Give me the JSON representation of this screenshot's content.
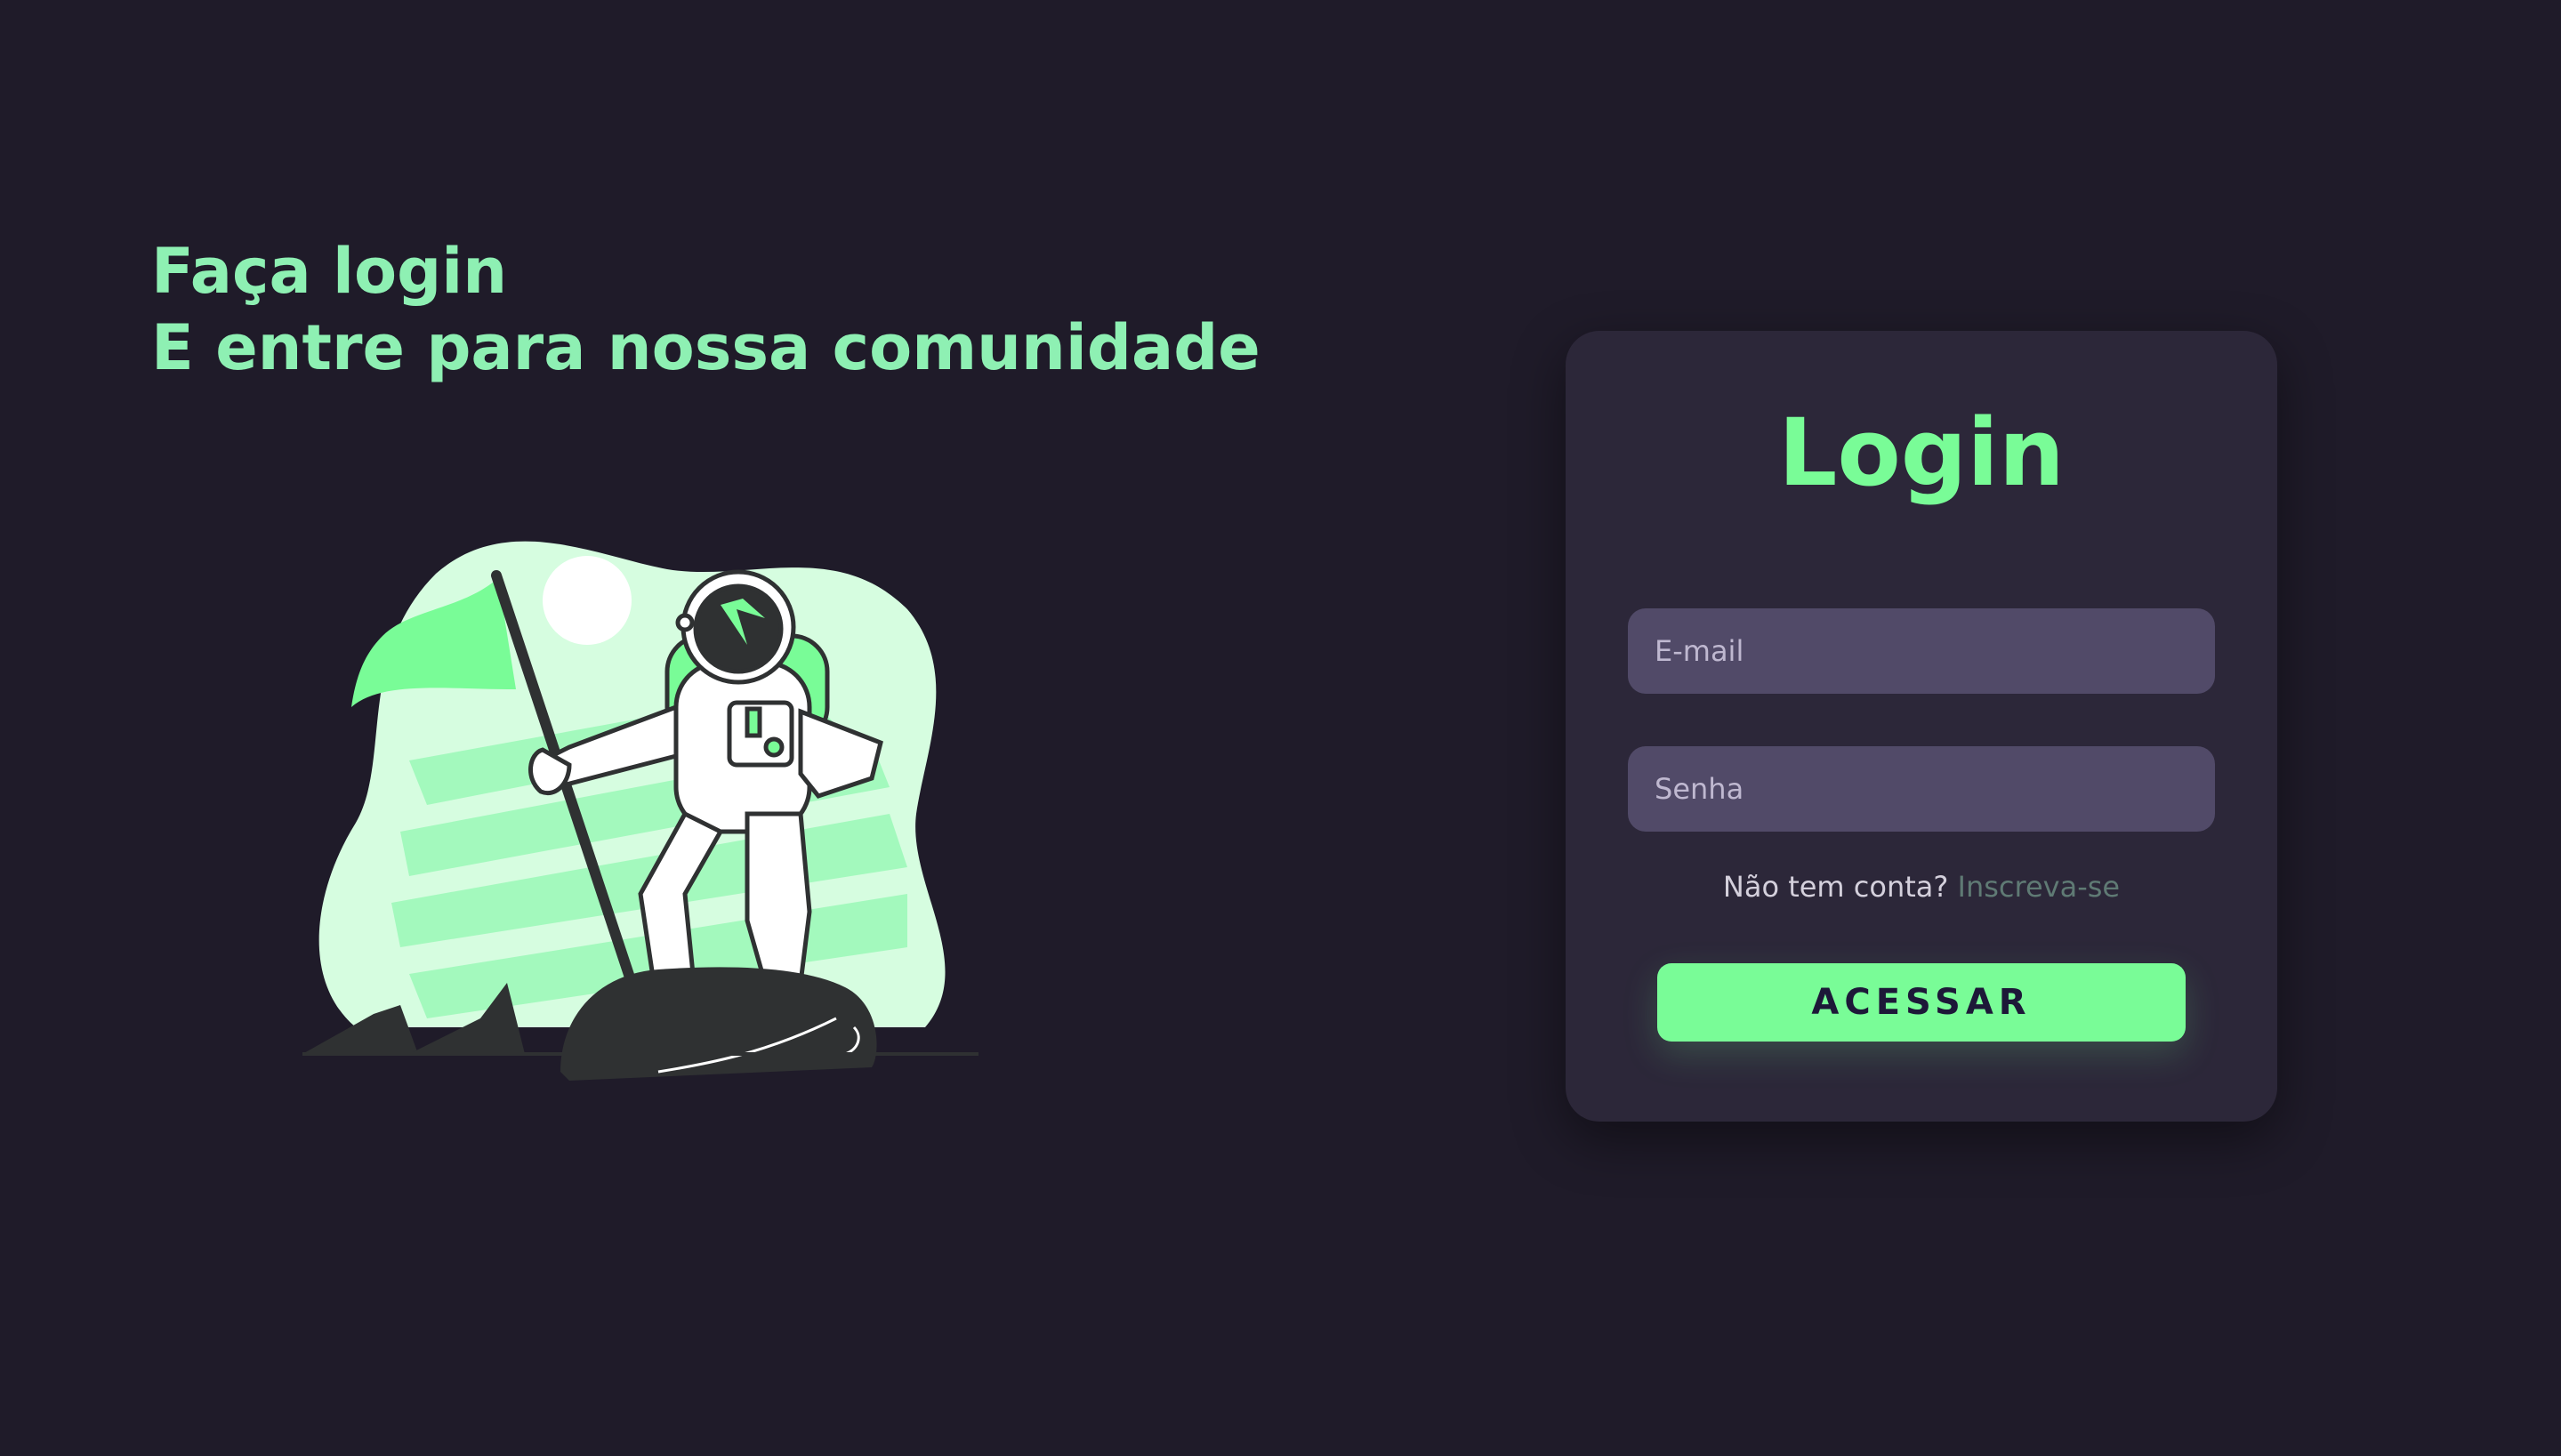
{
  "hero": {
    "line1": "Faça login",
    "line2": "E entre para nossa comunidade"
  },
  "illustration": {
    "icon": "astronaut-with-flag-illustration"
  },
  "login_card": {
    "title": "Login",
    "email_placeholder": "E-mail",
    "password_placeholder": "Senha",
    "signup_prompt": "Não tem conta?",
    "signup_link": "Inscreva-se",
    "submit_label": "ACESSAR"
  },
  "colors": {
    "background": "#1f1b29",
    "card": "#2c2739",
    "accent": "#79fc97",
    "heading": "#8ef0b3",
    "input_bg": "#514a68"
  }
}
